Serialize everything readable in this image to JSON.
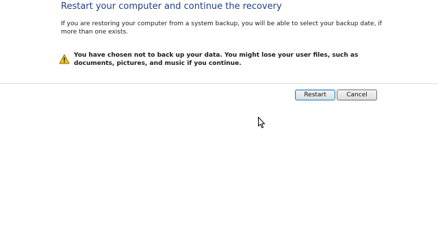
{
  "header": {
    "title": "Restart your computer and continue the recovery"
  },
  "main": {
    "description": "If you are restoring your computer from a system backup, you will be able to select your backup date, if more than one exists.",
    "warning": {
      "icon": "warning-triangle-icon",
      "text": "You have chosen not to back up your data. You might lose your user files, such as documents, pictures, and music if you continue."
    }
  },
  "buttons": {
    "restart_label": "Restart",
    "cancel_label": "Cancel"
  },
  "pointer": {
    "icon": "mouse-pointer-icon"
  },
  "colors": {
    "title": "#1e3f87",
    "warning": "#f6c21a"
  }
}
